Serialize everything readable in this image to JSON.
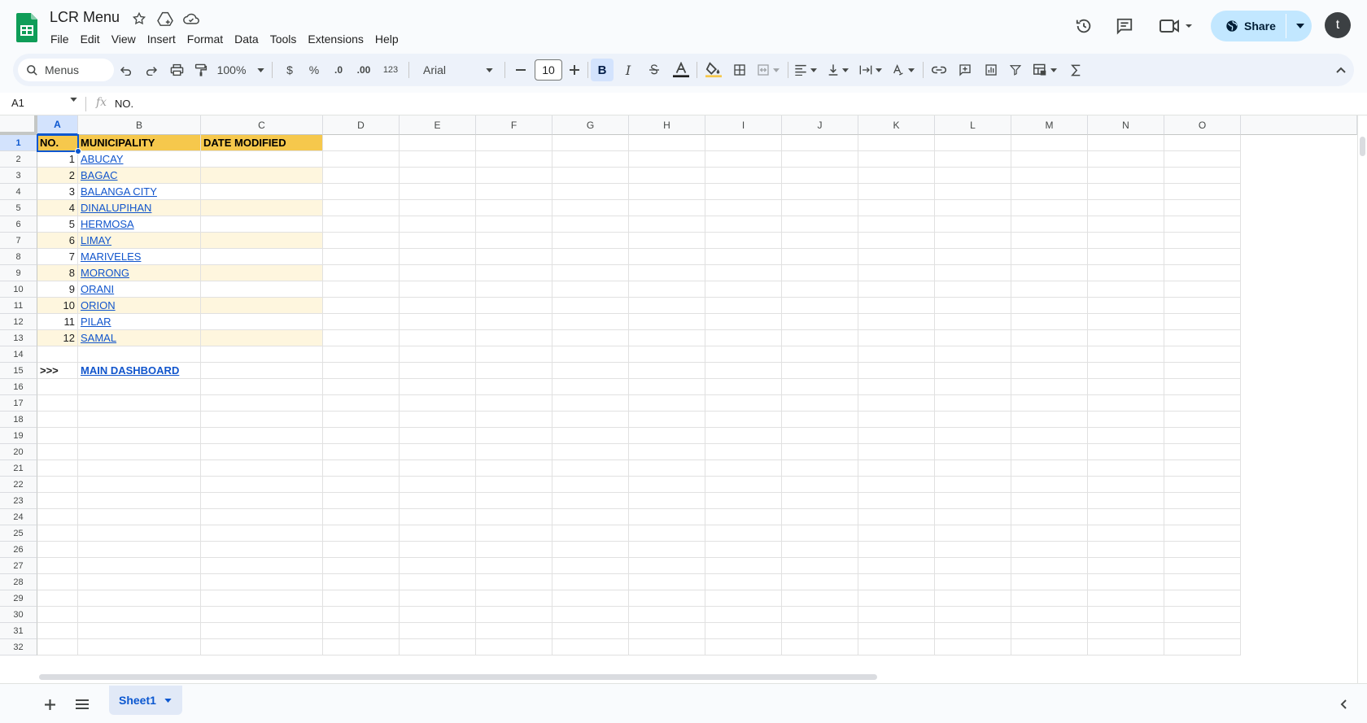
{
  "app": {
    "title": "LCR Menu",
    "menus": [
      "File",
      "Edit",
      "View",
      "Insert",
      "Format",
      "Data",
      "Tools",
      "Extensions",
      "Help"
    ],
    "share_label": "Share",
    "avatar_letter": "t"
  },
  "toolbar": {
    "search_label": "Menus",
    "zoom": "100%",
    "currency": "$",
    "percent": "%",
    "decrease_decimal": ".0",
    "increase_decimal": ".00",
    "number_format": "123",
    "font_name": "Arial",
    "font_size": "10",
    "bold": "B",
    "italic": "I"
  },
  "formula_bar": {
    "name_box": "A1",
    "fx": "fx",
    "value": "NO."
  },
  "grid": {
    "columns": [
      "A",
      "B",
      "C",
      "D",
      "E",
      "F",
      "G",
      "H",
      "I",
      "J",
      "K",
      "L",
      "M",
      "N",
      "O"
    ],
    "row_numbers": [
      "1",
      "2",
      "3",
      "4",
      "5",
      "6",
      "7",
      "8",
      "9",
      "10",
      "11",
      "12",
      "13",
      "14",
      "15",
      "16",
      "17",
      "18",
      "19",
      "20",
      "21",
      "22",
      "23",
      "24",
      "25",
      "26",
      "27",
      "28",
      "29",
      "30",
      "31",
      "32"
    ],
    "header": {
      "no": "NO.",
      "municipality": "MUNICIPALITY",
      "date_modified": "DATE MODIFIED"
    },
    "rows": [
      {
        "no": "1",
        "municipality": "ABUCAY"
      },
      {
        "no": "2",
        "municipality": "BAGAC"
      },
      {
        "no": "3",
        "municipality": "BALANGA CITY"
      },
      {
        "no": "4",
        "municipality": "DINALUPIHAN"
      },
      {
        "no": "5",
        "municipality": "HERMOSA"
      },
      {
        "no": "6",
        "municipality": "LIMAY"
      },
      {
        "no": "7",
        "municipality": "MARIVELES"
      },
      {
        "no": "8",
        "municipality": "MORONG"
      },
      {
        "no": "9",
        "municipality": "ORANI"
      },
      {
        "no": "10",
        "municipality": "ORION"
      },
      {
        "no": "11",
        "municipality": "PILAR"
      },
      {
        "no": "12",
        "municipality": "SAMAL"
      }
    ],
    "footer": {
      "arrow": ">>>",
      "link": "MAIN DASHBOARD"
    }
  },
  "sheets": [
    {
      "name": "Sheet1"
    }
  ],
  "colors": {
    "header_fill": "#f6c84c",
    "band_fill": "#fef6de",
    "link": "#1155cc",
    "accent": "#0b57d0"
  }
}
